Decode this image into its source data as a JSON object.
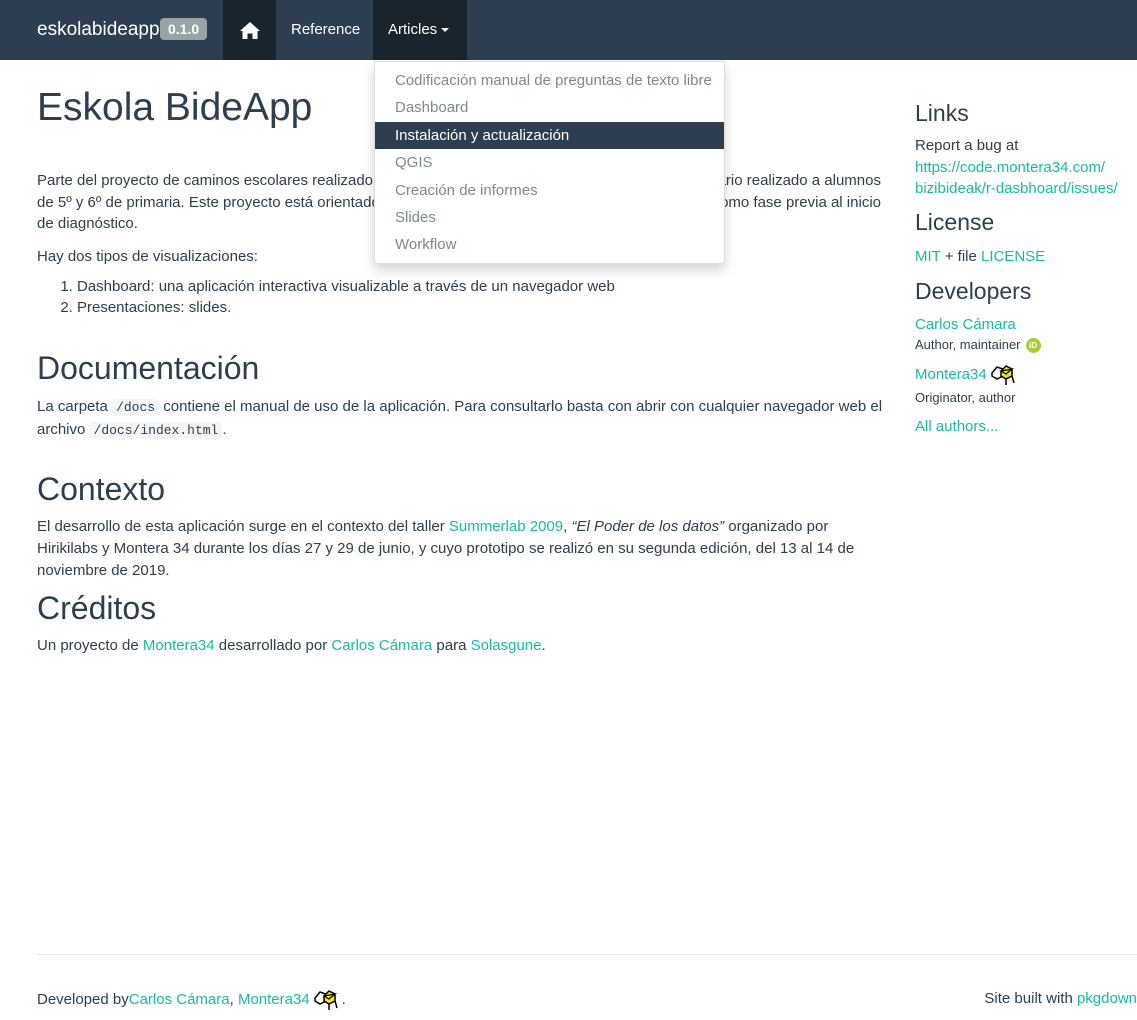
{
  "navbar": {
    "brand": "eskolabideapp",
    "version": "0.1.0",
    "home_icon": "home-icon",
    "reference": "Reference",
    "articles": "Articles"
  },
  "dropdown": {
    "items": [
      "Codificación manual de preguntas de texto libre",
      "Dashboard",
      "Instalación y actualización",
      "QGIS",
      "Creación de informes",
      "Slides",
      "Workflow"
    ],
    "active_index": 2
  },
  "main": {
    "title": "Eskola BideApp",
    "intro": {
      "part1": "Parte del proyecto de caminos escolares realizado po",
      "part1b": "ario realizado a alumnos",
      "part2": "de 5º y 6º de primaria. Este proyecto está orientado",
      "part2b": "como fase previa al inicio",
      "part3": "de diagnóstico."
    },
    "types_intro": "Hay dos tipos de visualizaciones:",
    "types": [
      "Dashboard: una aplicación interactiva visualizable a través de un navegador web",
      "Presentaciones: slides."
    ],
    "doc_heading": "Documentación",
    "doc_text1": "La carpeta ",
    "doc_code1": "/docs",
    "doc_text2": " contiene el manual de uso de la aplicación. Para consultarlo basta con abrir con cualquier navegador web el archivo ",
    "doc_code2": "/docs/index.html",
    "doc_text3": ".",
    "ctx_heading": "Contexto",
    "ctx_text1": "El desarrollo de esta aplicación surge en el contexto del taller ",
    "ctx_link": "Summerlab 2009",
    "ctx_text2": ", ",
    "ctx_em": "“El Poder de los datos”",
    "ctx_text3": " organizado por Hirikilabs y Montera 34 durante los días 27 y 29 de junio, y cuyo prototipo se realizó en su segunda edición, del 13 al 14 de noviembre de 2019.",
    "cred_heading": "Créditos",
    "cred_text1": "Un proyecto de ",
    "cred_link1": "Montera34",
    "cred_text2": " desarrollado por ",
    "cred_link2": "Carlos Cámara",
    "cred_text3": " para ",
    "cred_link3": "Solasgune",
    "cred_text4": "."
  },
  "sidebar": {
    "links_heading": "Links",
    "report_text": "Report a bug at",
    "report_link1": "https://code.montera34.com/",
    "report_link2": "bizibideak/r-dasbhoard/issues/",
    "license_heading": "License",
    "license_mit": "MIT",
    "license_plus": " + file ",
    "license_file": "LICENSE",
    "dev_heading": "Developers",
    "dev1_name": "Carlos Cámara",
    "dev1_role": "Author, maintainer",
    "orcid_label": "iD",
    "dev2_name": "Montera34",
    "dev2_role": "Originator, author",
    "all_authors": "All authors..."
  },
  "footer": {
    "developed_by": "Developed by ",
    "dev1": "Carlos Cámara",
    "sep": ", ",
    "dev2": "Montera34",
    "dot": ".",
    "built_with": "Site built with ",
    "pkgdown": "pkgdown"
  }
}
